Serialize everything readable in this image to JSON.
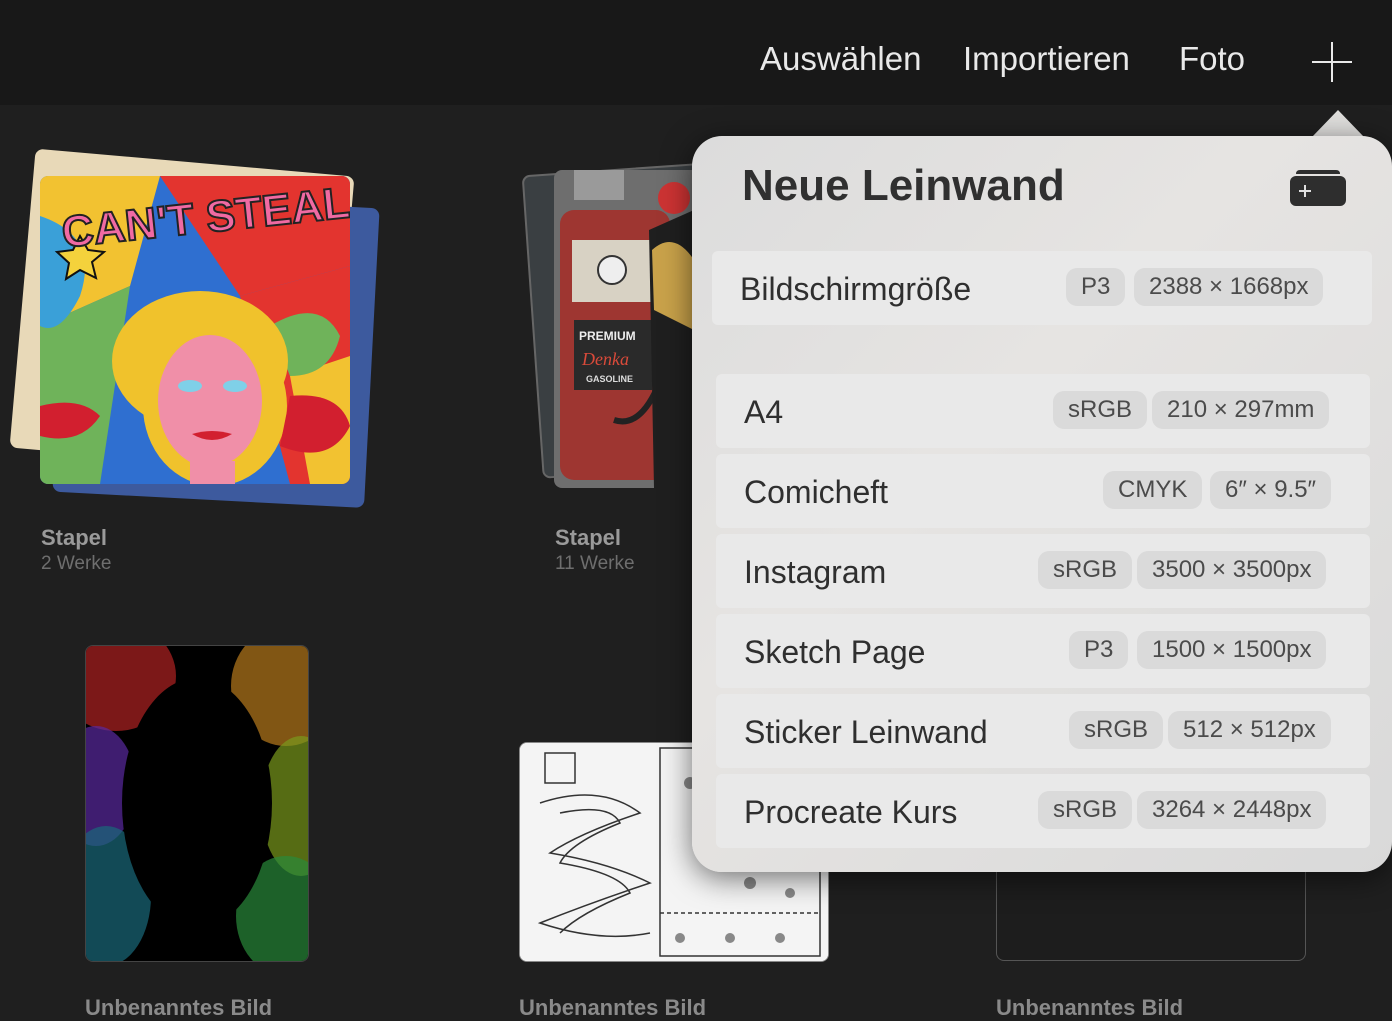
{
  "toolbar": {
    "select_label": "Auswählen",
    "import_label": "Importieren",
    "photo_label": "Foto"
  },
  "gallery": {
    "items": [
      {
        "title": "Stapel",
        "count": "2 Werke"
      },
      {
        "title": "Stapel",
        "count": "11 Werke"
      }
    ],
    "art_text": {
      "pop_art": "CAN'T STEAL ME LOVE",
      "pump_top": "PREMIUM",
      "pump_brand": "Denka",
      "pump_sub": "GASOLINE"
    },
    "cut_titles": [
      "Unbenanntes Bild",
      "Unbenanntes Bild",
      "Unbenanntes Bild"
    ]
  },
  "popover": {
    "title": "Neue Leinwand",
    "presets": [
      {
        "name": "Bildschirmgröße",
        "color": "P3",
        "size": "2388 × 1668px"
      },
      {
        "name": "A4",
        "color": "sRGB",
        "size": "210 × 297mm"
      },
      {
        "name": "Comicheft",
        "color": "CMYK",
        "size": "6″ × 9.5″"
      },
      {
        "name": "Instagram",
        "color": "sRGB",
        "size": "3500 × 3500px"
      },
      {
        "name": "Sketch Page",
        "color": "P3",
        "size": "1500 × 1500px"
      },
      {
        "name": "Sticker Leinwand",
        "color": "sRGB",
        "size": "512 × 512px"
      },
      {
        "name": "Procreate Kurs",
        "color": "sRGB",
        "size": "3264 × 2448px"
      }
    ]
  }
}
